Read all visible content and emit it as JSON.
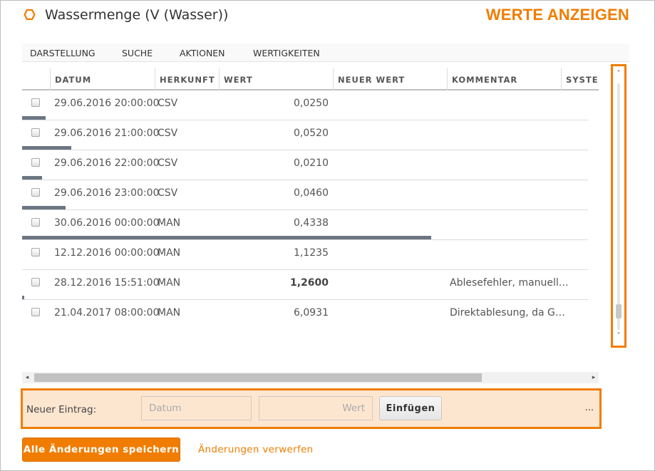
{
  "header": {
    "title": "Wassermenge (V (Wasser))",
    "section": "WERTE ANZEIGEN",
    "icon": "hexagon-icon",
    "accent_color": "#f07d00"
  },
  "menu": {
    "items": [
      "Darstellung",
      "Suche",
      "Aktionen",
      "Wertigkeiten"
    ]
  },
  "grid": {
    "columns": [
      "Datum",
      "Herkunft",
      "Wert",
      "Neuer Wert",
      "Kommentar",
      "Systen"
    ],
    "rows": [
      {
        "datum": "29.06.2016 20:00:00",
        "herkunft": "CSV",
        "wert": "0,0250",
        "kommentar": "",
        "bold": false,
        "level": 0.025
      },
      {
        "datum": "29.06.2016 21:00:00",
        "herkunft": "CSV",
        "wert": "0,0520",
        "kommentar": "",
        "bold": false,
        "level": 0.052
      },
      {
        "datum": "29.06.2016 22:00:00",
        "herkunft": "CSV",
        "wert": "0,0210",
        "kommentar": "",
        "bold": false,
        "level": 0.021
      },
      {
        "datum": "29.06.2016 23:00:00",
        "herkunft": "CSV",
        "wert": "0,0460",
        "kommentar": "",
        "bold": false,
        "level": 0.046
      },
      {
        "datum": "30.06.2016 00:00:00",
        "herkunft": "MAN",
        "wert": "0,4338",
        "kommentar": "",
        "bold": false,
        "level": 0.4338
      },
      {
        "datum": "12.12.2016 00:00:00",
        "herkunft": "MAN",
        "wert": "1,1235",
        "kommentar": "",
        "bold": false,
        "level": 0
      },
      {
        "datum": "28.12.2016 15:51:00",
        "herkunft": "MAN",
        "wert": "1,2600",
        "kommentar": "Ablesefehler, manuell…",
        "bold": true,
        "level": 0.002
      },
      {
        "datum": "21.04.2017 08:00:00",
        "herkunft": "MAN",
        "wert": "6,0931",
        "kommentar": "Direktablesung, da G…",
        "bold": false,
        "level": 0
      }
    ]
  },
  "scroll": {
    "vertical_position": 0.95,
    "horizontal_position": 0
  },
  "new_entry": {
    "label": "Neuer Eintrag:",
    "date_placeholder": "Datum",
    "value_placeholder": "Wert",
    "insert_label": "Einfügen",
    "more_label": "..."
  },
  "footer": {
    "save_label": "Alle Änderungen speichern",
    "discard_label": "Änderungen verwerfen"
  }
}
